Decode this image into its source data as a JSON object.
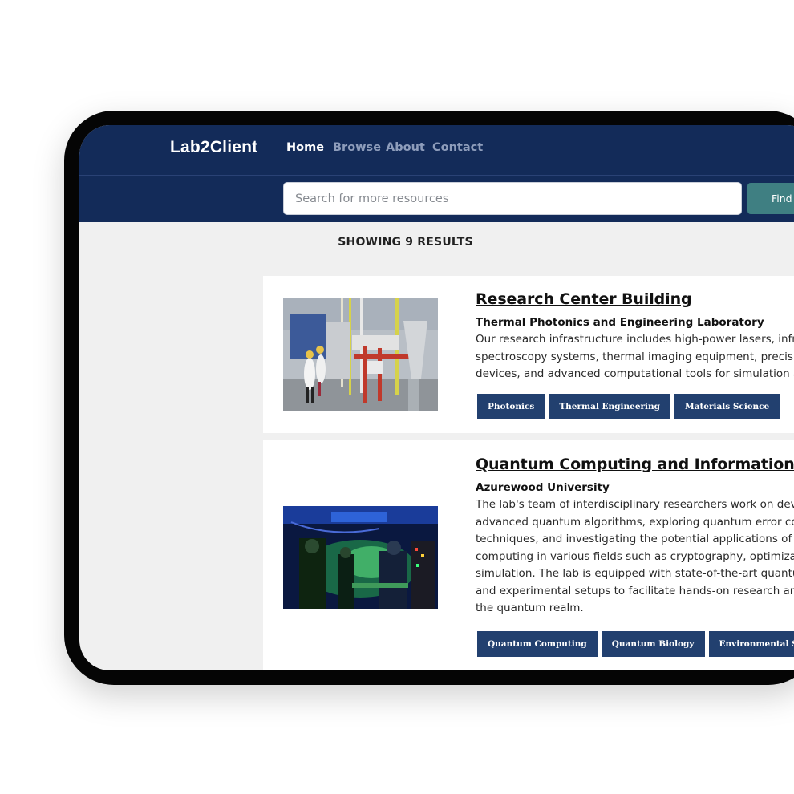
{
  "header": {
    "logo": "Lab2Client",
    "nav": [
      {
        "label": "Home",
        "active": true
      },
      {
        "label": "Browse",
        "active": false
      },
      {
        "label": "About",
        "active": false
      },
      {
        "label": "Contact",
        "active": false
      }
    ]
  },
  "search": {
    "placeholder": "Search for more resources",
    "value": "",
    "button_label": "Find R"
  },
  "results": {
    "count_label": "SHOWING 9 RESULTS",
    "items": [
      {
        "title": "Research Center Building",
        "subtitle": "Thermal Photonics and Engineering Laboratory",
        "description_lines": [
          "Our research infrastructure includes high-power lasers, infrared",
          "spectroscopy systems, thermal imaging equipment, precision m",
          "devices, and advanced computational tools for simulation and a"
        ],
        "tags": [
          "Photonics",
          "Thermal Engineering",
          "Materials Science"
        ]
      },
      {
        "title": "Quantum Computing and Information Lab",
        "subtitle": "Azurewood University",
        "description_lines": [
          "The lab's team of interdisciplinary researchers work on developi",
          "advanced quantum algorithms, exploring quantum error correc",
          "techniques, and investigating the potential applications of quan",
          "computing in various fields such as cryptography, optimization,",
          "simulation. The lab is equipped with state-of-the-art quantum c",
          "and experimental setups to facilitate hands-on research and exp",
          "the quantum realm."
        ],
        "tags": [
          "Quantum Computing",
          "Quantum Biology",
          "Environmental Science"
        ]
      }
    ]
  },
  "colors": {
    "header_bg": "#132b59",
    "tag_bg": "#22406f",
    "button_bg": "#3f7f82",
    "page_bg": "#f0f0f0"
  }
}
